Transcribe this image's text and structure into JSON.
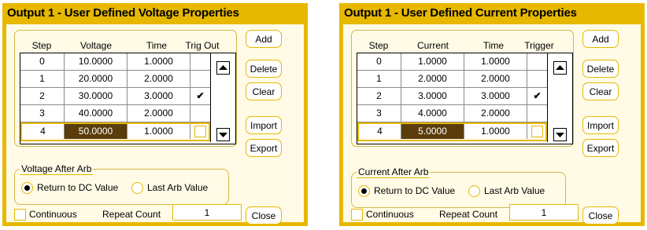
{
  "dialogs": [
    {
      "title": "Output 1 - User Defined Voltage Properties",
      "columns": [
        "Step",
        "Voltage",
        "Time",
        "Trig Out"
      ],
      "rows": [
        {
          "step": "0",
          "value": "10.0000",
          "time": "1.0000",
          "trig": ""
        },
        {
          "step": "1",
          "value": "20.0000",
          "time": "2.0000",
          "trig": ""
        },
        {
          "step": "2",
          "value": "30.0000",
          "time": "3.0000",
          "trig": "✔"
        },
        {
          "step": "3",
          "value": "40.0000",
          "time": "2.0000",
          "trig": ""
        },
        {
          "step": "4",
          "value": "50.0000",
          "time": "1.0000",
          "trig": ""
        }
      ],
      "buttons": {
        "add": "Add",
        "delete": "Delete",
        "clear": "Clear",
        "import": "Import",
        "export": "Export",
        "close": "Close"
      },
      "after_arb": {
        "label": "Voltage After Arb",
        "option1": "Return to DC Value",
        "option2": "Last Arb Value"
      },
      "continuous": "Continuous",
      "repeat_count": {
        "label": "Repeat Count",
        "value": "1"
      }
    },
    {
      "title": "Output 1 - User Defined Current Properties",
      "columns": [
        "Step",
        "Current",
        "Time",
        "Trigger"
      ],
      "rows": [
        {
          "step": "0",
          "value": "1.0000",
          "time": "1.0000",
          "trig": ""
        },
        {
          "step": "1",
          "value": "2.0000",
          "time": "2.0000",
          "trig": ""
        },
        {
          "step": "2",
          "value": "3.0000",
          "time": "3.0000",
          "trig": "✔"
        },
        {
          "step": "3",
          "value": "4.0000",
          "time": "2.0000",
          "trig": ""
        },
        {
          "step": "4",
          "value": "5.0000",
          "time": "1.0000",
          "trig": ""
        }
      ],
      "buttons": {
        "add": "Add",
        "delete": "Delete",
        "clear": "Clear",
        "import": "Import",
        "export": "Export",
        "close": "Close"
      },
      "after_arb": {
        "label": "Current After Arb",
        "option1": "Return to DC Value",
        "option2": "Last Arb Value"
      },
      "continuous": "Continuous",
      "repeat_count": {
        "label": "Repeat Count",
        "value": "1"
      }
    }
  ]
}
